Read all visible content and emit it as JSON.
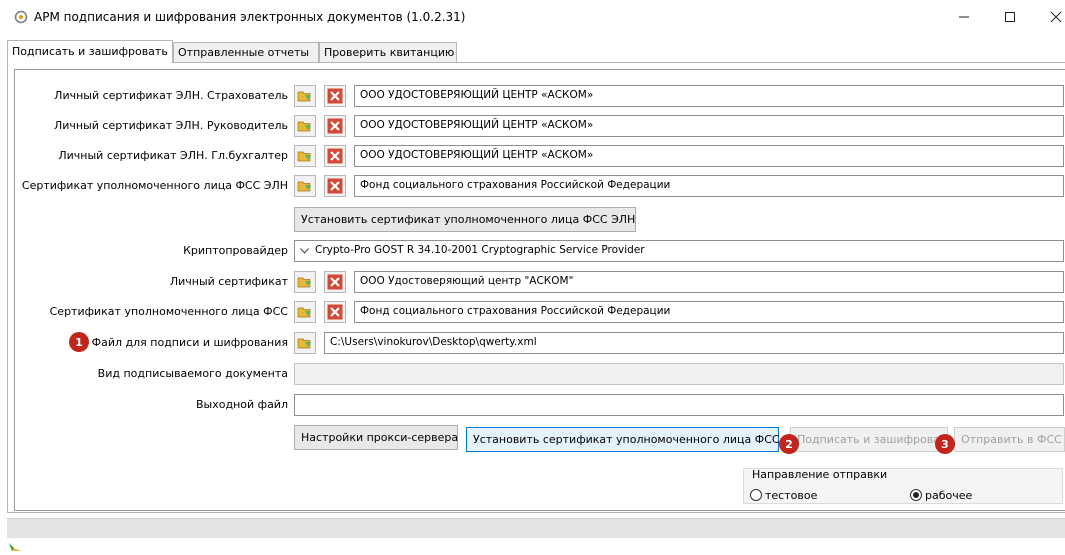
{
  "window": {
    "title": "АРМ подписания и шифрования электронных документов (1.0.2.31)"
  },
  "tabs": [
    {
      "label": "Подписать и зашифровать",
      "active": true
    },
    {
      "label": "Отправленные отчеты",
      "active": false
    },
    {
      "label": "Проверить квитанцию",
      "active": false
    }
  ],
  "certs": [
    {
      "label": "Личный сертификат ЭЛН. Страхователь",
      "value": "ООО УДОСТОВЕРЯЮЩИЙ ЦЕНТР «АСКОМ»"
    },
    {
      "label": "Личный сертификат ЭЛН. Руководитель",
      "value": "ООО УДОСТОВЕРЯЮЩИЙ ЦЕНТР «АСКОМ»"
    },
    {
      "label": "Личный сертификат ЭЛН. Гл.бухгалтер",
      "value": "ООО УДОСТОВЕРЯЮЩИЙ ЦЕНТР «АСКОМ»"
    },
    {
      "label": "Сертификат уполномоченного лица ФСС ЭЛН",
      "value": "Фонд социального страхования Российской Федерации"
    }
  ],
  "install_eln_button": "Установить сертификат уполномоченного лица ФСС ЭЛН",
  "crypto": {
    "label": "Криптопровайдер",
    "value": "Crypto-Pro GOST R 34.10-2001 Cryptographic Service Provider"
  },
  "personal_cert": {
    "label": "Личный сертификат",
    "value": "ООО Удостоверяющий центр \"АСКОМ\""
  },
  "fss_cert": {
    "label": "Сертификат уполномоченного лица ФСС",
    "value": "Фонд социального страхования Российской Федерации"
  },
  "file": {
    "label": "Файл для подписи и шифрования",
    "value": "C:\\Users\\vinokurov\\Desktop\\qwerty.xml"
  },
  "doc_type": {
    "label": "Вид подписываемого документа",
    "value": ""
  },
  "output_file": {
    "label": "Выходной файл",
    "value": ""
  },
  "buttons": {
    "proxy": "Настройки прокси-сервера",
    "install_fss": "Установить сертификат уполномоченного лица ФСС",
    "sign": "Подписать и зашифровать",
    "send": "Отправить в ФСС"
  },
  "direction": {
    "title": "Направление отправки",
    "options": [
      {
        "label": "тестовое",
        "checked": false
      },
      {
        "label": "рабочее",
        "checked": true
      }
    ]
  },
  "badges": [
    "1",
    "2",
    "3"
  ],
  "icons": {
    "app": "app-icon",
    "open": "open-folder-icon",
    "delete": "delete-x-icon",
    "minimize": "minimize-icon",
    "maximize": "maximize-icon",
    "close": "close-icon",
    "chevron": "chevron-down-icon",
    "status": "status-icon"
  },
  "colors": {
    "badge": "#c0261c",
    "focus_border": "#0078d7",
    "delete_icon": "#d24a36",
    "folder_icon": "#e8b83c"
  }
}
